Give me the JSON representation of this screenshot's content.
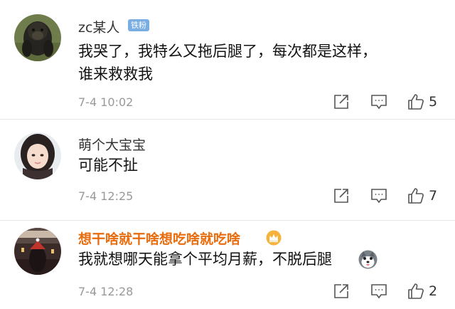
{
  "comments": [
    {
      "username": "zc某人",
      "badge": "铁粉",
      "text": "我哭了，我特么又拖后腿了，每次都是这样，谁来救救我",
      "time": "7-4 10:02",
      "like_count": "5",
      "avatar_icon": "gorilla-avatar"
    },
    {
      "username": "萌个大宝宝",
      "text": "可能不扯",
      "time": "7-4 12:25",
      "like_count": "7",
      "avatar_icon": "girl-avatar"
    },
    {
      "username": "想干啥就干啥想吃啥就吃啥",
      "text": "我就想哪天能拿个平均月薪，不脱后腿",
      "time": "7-4 12:28",
      "like_count": "2",
      "avatar_icon": "night-scene-avatar",
      "name_color": "#e86b0c"
    }
  ],
  "icons": {
    "share": "share-icon",
    "reply": "comment-icon",
    "like": "thumbs-up-icon",
    "crown": "crown-icon",
    "emoji": "husky-emoji-icon"
  }
}
